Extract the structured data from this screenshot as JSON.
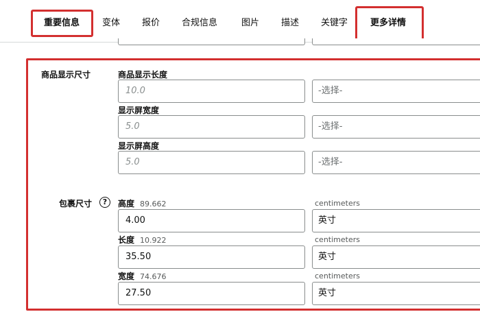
{
  "tabs": [
    {
      "label": "重要信息"
    },
    {
      "label": "变体"
    },
    {
      "label": "报价"
    },
    {
      "label": "合规信息"
    },
    {
      "label": "图片"
    },
    {
      "label": "描述"
    },
    {
      "label": "关键字"
    },
    {
      "label": "更多详情"
    }
  ],
  "display_size": {
    "section_label": "商品显示尺寸",
    "fields": [
      {
        "label": "商品显示长度",
        "placeholder": "10.0",
        "unit": "-选择-"
      },
      {
        "label": "显示屏宽度",
        "placeholder": "5.0",
        "unit": "-选择-"
      },
      {
        "label": "显示屏高度",
        "placeholder": "5.0",
        "unit": "-选择-"
      }
    ]
  },
  "package_size": {
    "section_label": "包裹尺寸",
    "help_icon": "question-circle-icon",
    "fields": [
      {
        "label": "高度",
        "hint": "89.662",
        "unit_hint": "centimeters",
        "value": "4.00",
        "unit": "英寸"
      },
      {
        "label": "长度",
        "hint": "10.922",
        "unit_hint": "centimeters",
        "value": "35.50",
        "unit": "英寸"
      },
      {
        "label": "宽度",
        "hint": "74.676",
        "unit_hint": "centimeters",
        "value": "27.50",
        "unit": "英寸"
      }
    ]
  },
  "colors": {
    "highlight": "#d32f2f",
    "border": "#888c8c"
  }
}
